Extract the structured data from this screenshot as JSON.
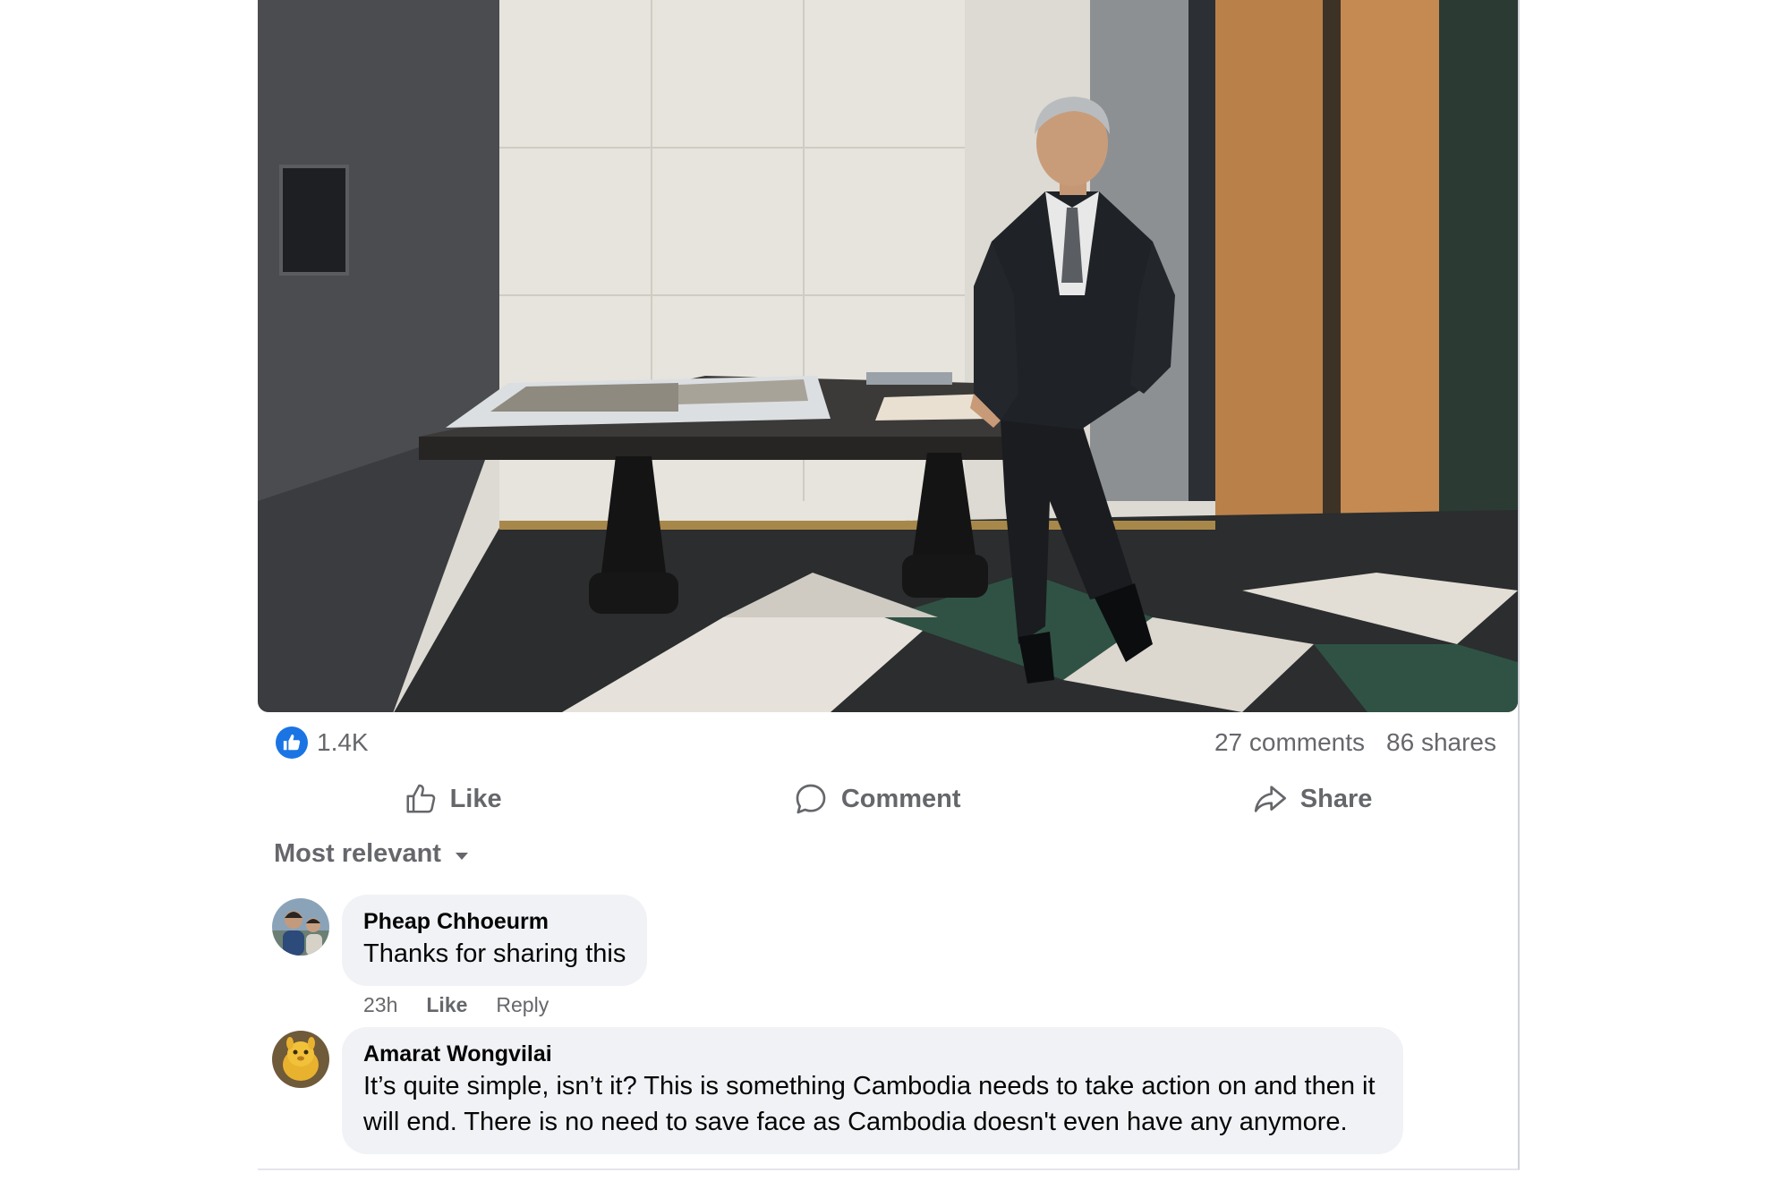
{
  "post": {
    "photo_alt": "",
    "reactions": {
      "icon": "thumbs-up-icon",
      "count": "1.4K"
    },
    "comments_count": "27 comments",
    "shares_count": "86 shares"
  },
  "actions": {
    "like_label": "Like",
    "comment_label": "Comment",
    "share_label": "Share"
  },
  "sort": {
    "label": "Most relevant",
    "icon": "caret-down-icon"
  },
  "comments": [
    {
      "author": "Pheap Chhoeurm",
      "text": "Thanks for sharing this",
      "time": "23h",
      "like_label": "Like",
      "reply_label": "Reply"
    },
    {
      "author": "Amarat Wongvilai",
      "text": "It’s quite simple, isn’t it? This is something Cambodia needs to take action on and then it will end. There is no need to save face as Cambodia doesn't even have any anymore."
    }
  ],
  "colors": {
    "accent": "#1b74e4",
    "secondary_text": "#65676b",
    "bubble": "#f0f2f5"
  }
}
